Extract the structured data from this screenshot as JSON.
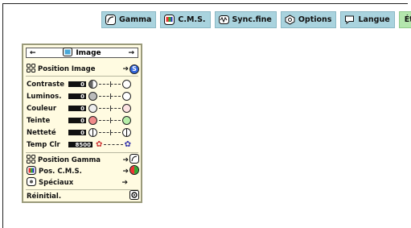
{
  "tabs": [
    {
      "label": "Gamma",
      "icon": "gamma-icon"
    },
    {
      "label": "C.M.S.",
      "icon": "cms-icon"
    },
    {
      "label": "Sync.fine",
      "icon": "sync-icon"
    },
    {
      "label": "Options",
      "icon": "options-icon"
    },
    {
      "label": "Langue",
      "icon": "langue-icon"
    },
    {
      "label": "État",
      "active": true
    }
  ],
  "menu": {
    "header": {
      "left_arrow": "←",
      "title": "Image",
      "right_arrow": "→"
    },
    "position_image": {
      "label": "Position Image",
      "arrow": "➔",
      "badge": "S"
    },
    "sliders": [
      {
        "label": "Contraste",
        "value": "0"
      },
      {
        "label": "Luminos.",
        "value": "0"
      },
      {
        "label": "Couleur",
        "value": "0"
      },
      {
        "label": "Teinte",
        "value": "0"
      },
      {
        "label": "Netteté",
        "value": "0"
      }
    ],
    "temp": {
      "label": "Temp Clr",
      "value": "8500"
    },
    "items": [
      {
        "label": "Position Gamma",
        "arrow": "➔"
      },
      {
        "label": "Pos. C.M.S.",
        "arrow": "➔"
      },
      {
        "label": "Spéciaux",
        "arrow": "➔"
      },
      {
        "label": "Réinitial."
      }
    ]
  },
  "colors": {
    "tab": "#a9d3de",
    "tab_active": "#b4e6ad",
    "menu_bg": "#fffbe1",
    "teinte_red": "#f08a8a",
    "teinte_green": "#b6efa9"
  }
}
